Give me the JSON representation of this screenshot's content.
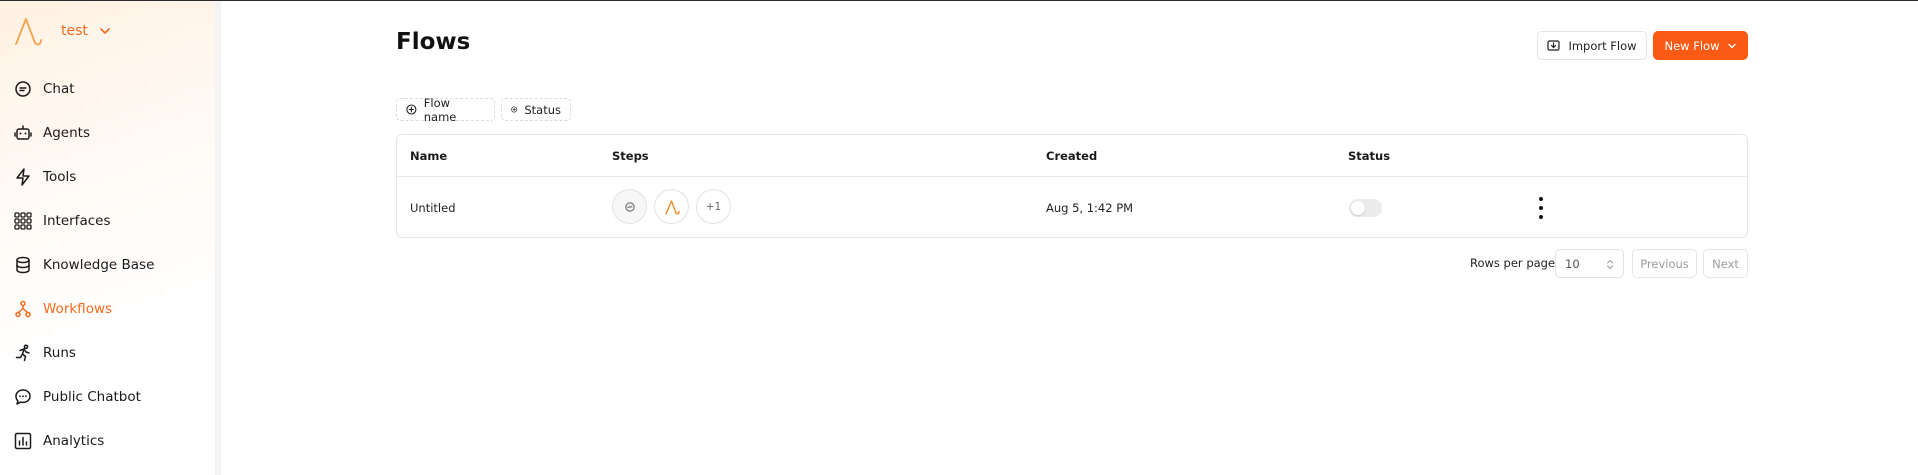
{
  "workspace": {
    "name": "test"
  },
  "nav": {
    "items": [
      {
        "label": "Chat",
        "icon": "chat-icon"
      },
      {
        "label": "Agents",
        "icon": "robot-icon"
      },
      {
        "label": "Tools",
        "icon": "lightning-icon"
      },
      {
        "label": "Interfaces",
        "icon": "grid-icon"
      },
      {
        "label": "Knowledge Base",
        "icon": "database-icon"
      },
      {
        "label": "Workflows",
        "icon": "workflow-icon",
        "active": true
      },
      {
        "label": "Runs",
        "icon": "runner-icon"
      },
      {
        "label": "Public Chatbot",
        "icon": "chat-bubble-icon"
      },
      {
        "label": "Analytics",
        "icon": "chart-icon"
      }
    ]
  },
  "header": {
    "title": "Flows",
    "import_label": "Import Flow",
    "new_label": "New Flow"
  },
  "filters": {
    "flow_name": "Flow name",
    "status": "Status"
  },
  "table": {
    "columns": {
      "name": "Name",
      "steps": "Steps",
      "created": "Created",
      "status": "Status"
    },
    "rows": [
      {
        "name": "Untitled",
        "extra_steps": "+1",
        "created": "Aug 5, 1:42 PM",
        "status_enabled": false
      }
    ]
  },
  "pagination": {
    "rows_per_page_label": "Rows per page",
    "rows_per_page": "10",
    "previous": "Previous",
    "next": "Next"
  },
  "colors": {
    "accent": "#fa5a14",
    "brand": "#f26b1d"
  }
}
